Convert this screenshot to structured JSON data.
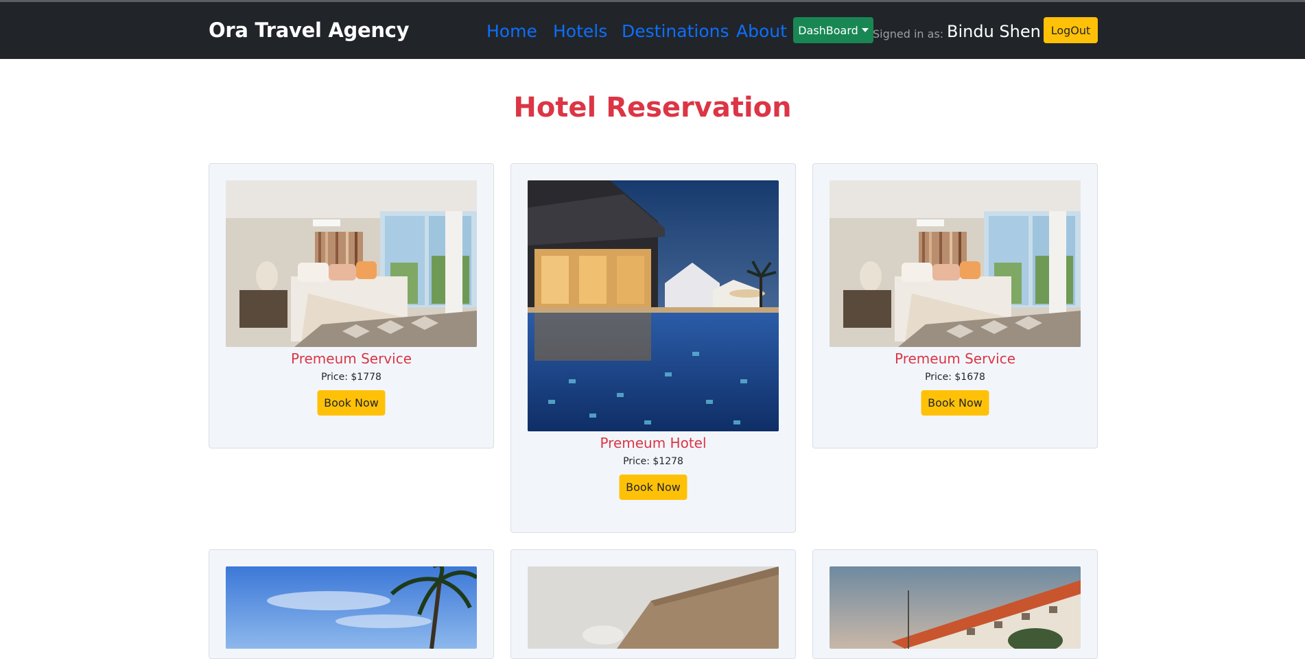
{
  "navbar": {
    "brand": "Ora Travel Agency",
    "links": [
      "Home",
      "Hotels",
      "Destinations",
      "About"
    ],
    "dashboard_label": "DashBoard",
    "signed_in_label": "Signed in as:",
    "user_name": "Bindu Shen",
    "logout_label": "LogOut",
    "colors": {
      "background": "#212529",
      "link": "#0d6efd",
      "dashboard": "#198754",
      "logout": "#ffc107"
    }
  },
  "page": {
    "title": "Hotel Reservation",
    "title_color": "#dc3545"
  },
  "cards": [
    {
      "title": "Premeum Service",
      "price": "Price: $1778",
      "button": "Book Now",
      "image": "bedroom-photo"
    },
    {
      "title": "Premeum Hotel",
      "price": "Price: $1278",
      "button": "Book Now",
      "image": "pool-night-photo"
    },
    {
      "title": "Premeum Service",
      "price": "Price: $1678",
      "button": "Book Now",
      "image": "bedroom-photo"
    },
    {
      "image": "palm-sky-photo"
    },
    {
      "image": "building-wall-photo"
    },
    {
      "image": "resort-building-photo"
    }
  ]
}
